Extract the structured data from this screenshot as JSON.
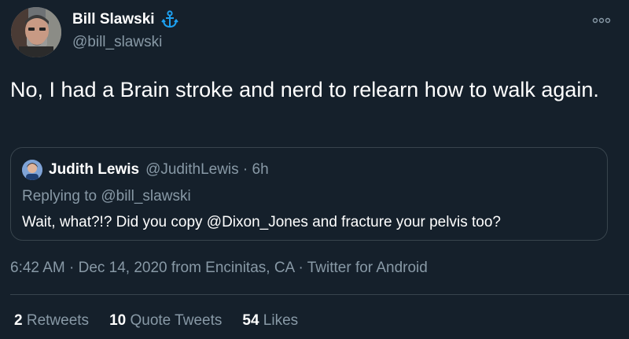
{
  "author": {
    "display_name": "Bill Slawski",
    "handle": "@bill_slawski"
  },
  "tweet": {
    "text": "No, I had a Brain stroke and nerd to relearn how to walk again."
  },
  "quoted_tweet": {
    "display_name": "Judith Lewis",
    "handle_time": "@JudithLewis · 6h",
    "replying_prefix": "Replying to ",
    "replying_to": "@bill_slawski",
    "text": "Wait, what?!? Did you copy @Dixon_Jones and fracture your pelvis too?"
  },
  "meta": {
    "line": "6:42 AM · Dec 14, 2020 from Encinitas, CA · Twitter for Android"
  },
  "stats": {
    "retweets_count": "2",
    "retweets_label": "Retweets",
    "quote_tweets_count": "10",
    "quote_tweets_label": "Quote Tweets",
    "likes_count": "54",
    "likes_label": "Likes"
  },
  "icons": {
    "verified_like": "anchor-icon",
    "more": "more-options-icon"
  },
  "colors": {
    "background": "#15202b",
    "secondary_text": "#8899a6",
    "border": "#38444d",
    "accent": "#1da1f2"
  }
}
